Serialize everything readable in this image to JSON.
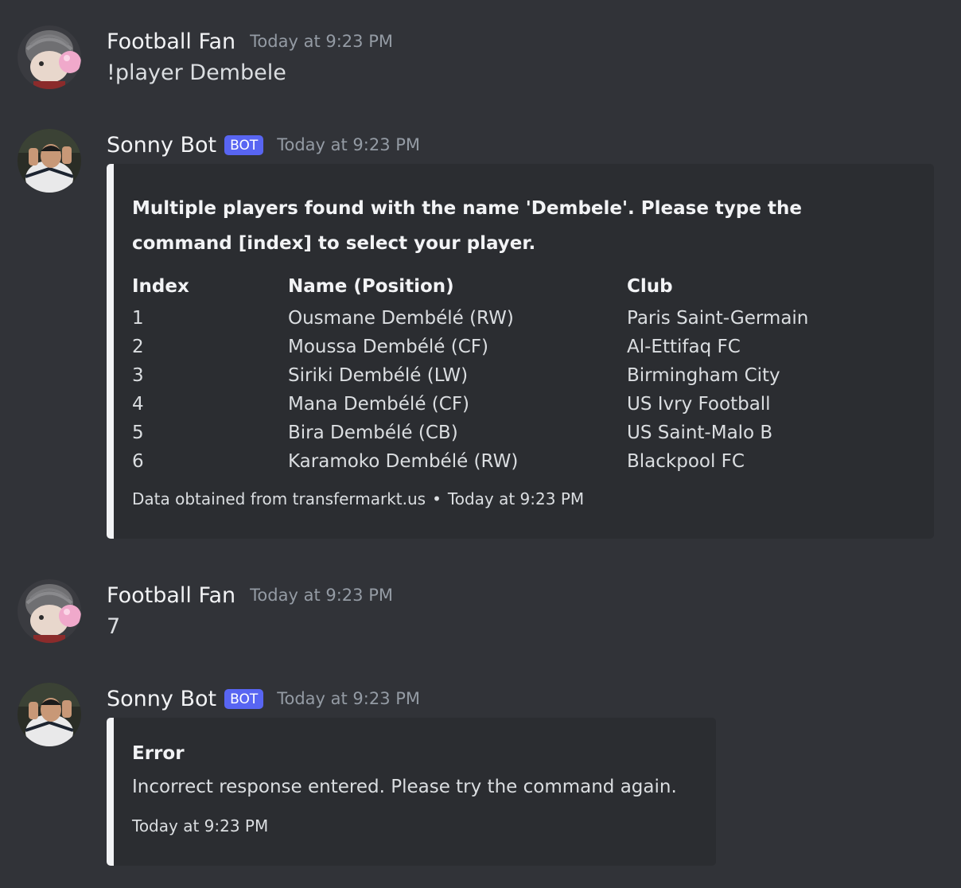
{
  "colors": {
    "background": "#313338",
    "embed_background": "#2b2d31",
    "embed_accent": "#f2f3f5",
    "bot_tag": "#5865f2",
    "timestamp": "#949ba4"
  },
  "messages": [
    {
      "author": "Football Fan",
      "avatar": "bubblegum-character-avatar",
      "timestamp": "Today at 9:23 PM",
      "text": "!player Dembele"
    },
    {
      "author": "Sonny Bot",
      "bot_tag": "BOT",
      "avatar": "football-player-photo-avatar",
      "timestamp": "Today at 9:23 PM",
      "embed": {
        "description": "Multiple players found with the name 'Dembele'. Please type the command [index] to select your player.",
        "fields": [
          {
            "name": "Index",
            "values": [
              "1",
              "2",
              "3",
              "4",
              "5",
              "6"
            ]
          },
          {
            "name": "Name (Position)",
            "values": [
              "Ousmane Dembélé (RW)",
              "Moussa Dembélé (CF)",
              "Siriki Dembélé (LW)",
              "Mana Dembélé (CF)",
              "Bira Dembélé (CB)",
              "Karamoko Dembélé (RW)"
            ]
          },
          {
            "name": "Club",
            "values": [
              "Paris Saint-Germain",
              "Al-Ettifaq FC",
              "Birmingham City",
              "US Ivry Football",
              "US Saint-Malo B",
              "Blackpool FC"
            ]
          }
        ],
        "footer_text": "Data obtained from transfermarkt.us",
        "footer_separator": "•",
        "footer_timestamp": "Today at 9:23 PM"
      }
    },
    {
      "author": "Football Fan",
      "avatar": "bubblegum-character-avatar",
      "timestamp": "Today at 9:23 PM",
      "text": "7"
    },
    {
      "author": "Sonny Bot",
      "bot_tag": "BOT",
      "avatar": "football-player-photo-avatar",
      "timestamp": "Today at 9:23 PM",
      "embed": {
        "title": "Error",
        "description": "Incorrect response entered. Please try the command again.",
        "footer_timestamp": "Today at 9:23 PM"
      }
    }
  ]
}
